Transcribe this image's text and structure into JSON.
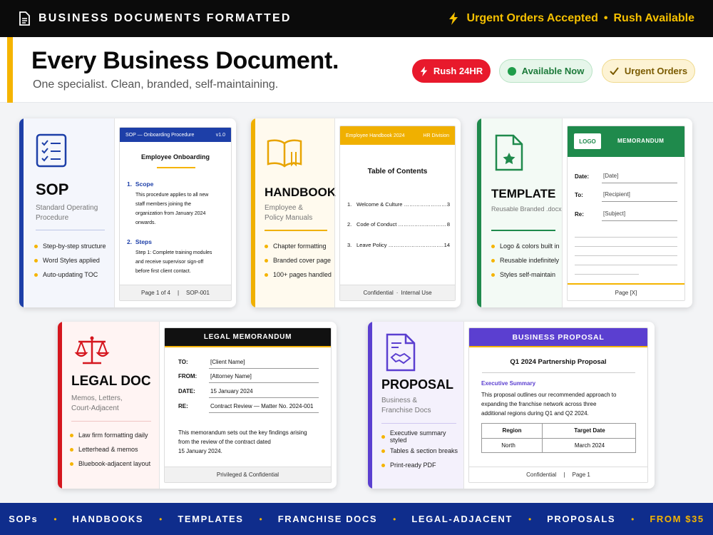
{
  "topbar": {
    "title": "BUSINESS DOCUMENTS FORMATTED",
    "urgent": "Urgent Orders Accepted",
    "rush": "Rush Available",
    "sep": "•"
  },
  "hero": {
    "title": "Every Business Document.",
    "subtitle": "One specialist. Clean, branded, self-maintaining.",
    "pills": {
      "rush": "Rush 24HR",
      "available": "Available Now",
      "urgent": "Urgent Orders"
    }
  },
  "cards": {
    "sop": {
      "title": "SOP",
      "sub1": "Standard Operating",
      "sub2": "Procedure",
      "bullets": [
        "Step-by-step structure",
        "Word Styles applied",
        "Auto-updating TOC"
      ],
      "doc": {
        "header": "SOP — Onboarding Procedure",
        "version": "v1.0",
        "title": "Employee Onboarding",
        "s1_num": "1.",
        "s1_title": "Scope",
        "s1_l1": "This procedure applies to all new",
        "s1_l2": "staff members joining the",
        "s1_l3": "organization from January 2024",
        "s1_l4": "onwards.",
        "s2_num": "2.",
        "s2_title": "Steps",
        "s2_l1": "Step 1: Complete training modules",
        "s2_l2": "and receive supervisor sign-off",
        "s2_l3": "before first client contact.",
        "foot1": "Page 1 of 4",
        "foot_sep": "|",
        "foot2": "SOP-001"
      }
    },
    "handbook": {
      "title": "HANDBOOK",
      "sub1": "Employee &",
      "sub2": "Policy Manuals",
      "bullets": [
        "Chapter formatting",
        "Branded cover page",
        "100+ pages handled"
      ],
      "doc": {
        "header": "Employee Handbook 2024",
        "division": "HR Division",
        "title": "Table of Contents",
        "toc": [
          {
            "n": "1.",
            "t": "Welcome & Culture ……………………",
            "p": "3"
          },
          {
            "n": "2.",
            "t": "Code of Conduct ………………………",
            "p": "8"
          },
          {
            "n": "3.",
            "t": "Leave Policy ……………………………",
            "p": "14"
          }
        ],
        "foot1": "Confidential",
        "foot_sep": "·",
        "foot2": "Internal Use"
      }
    },
    "template": {
      "title": "TEMPLATE",
      "sub1": "Reusable Branded .docx",
      "bullets": [
        "Logo & colors built in",
        "Reusable indefinitely",
        "Styles self-maintain"
      ],
      "doc": {
        "logo": "LOGO",
        "header": "MEMORANDUM",
        "date_l": "Date:",
        "date_v": "[Date]",
        "to_l": "To:",
        "to_v": "[Recipient]",
        "re_l": "Re:",
        "re_v": "[Subject]",
        "foot": "Page [X]"
      }
    },
    "legal": {
      "title": "LEGAL DOC",
      "sub1": "Memos, Letters,",
      "sub2": "Court-Adjacent",
      "bullets": [
        "Law firm formatting daily",
        "Letterhead & memos",
        "Bluebook-adjacent layout"
      ],
      "doc": {
        "header": "LEGAL MEMORANDUM",
        "to_l": "TO:",
        "to_v": "[Client Name]",
        "from_l": "FROM:",
        "from_v": "[Attorney Name]",
        "date_l": "DATE:",
        "date_v": "15 January 2024",
        "re_l": "RE:",
        "re_v": "Contract Review — Matter No. 2024-001",
        "body1": "This memorandum sets out the key findings arising",
        "body2": "from the review of the contract dated",
        "body3": "15 January 2024.",
        "foot": "Privileged & Confidential"
      }
    },
    "proposal": {
      "title": "PROPOSAL",
      "sub1": "Business &",
      "sub2": "Franchise Docs",
      "bullets": [
        "Executive summary styled",
        "Tables & section breaks",
        "Print-ready PDF"
      ],
      "doc": {
        "header": "BUSINESS PROPOSAL",
        "title": "Q1 2024 Partnership Proposal",
        "exec": "Executive Summary",
        "body1": "This proposal outlines our recommended approach to",
        "body2": "expanding the franchise network across three",
        "body3": "additional regions during Q1 and Q2 2024.",
        "col1": "Region",
        "col2": "Target Date",
        "cell1": "North",
        "cell2": "March 2024",
        "foot1": "Confidential",
        "foot_sep": "|",
        "foot2": "Page 1"
      }
    }
  },
  "bottombar": {
    "items": [
      "SOPs",
      "HANDBOOKS",
      "TEMPLATES",
      "FRANCHISE DOCS",
      "LEGAL-ADJACENT",
      "PROPOSALS"
    ],
    "sep": "•",
    "price": "FROM $35"
  },
  "colors": {
    "sop": "#1d3fa8",
    "handbook": "#f0b000",
    "template": "#1f8a4c",
    "legal": "#d5161e",
    "proposal": "#5b3fd0",
    "gold": "#f5b400"
  }
}
